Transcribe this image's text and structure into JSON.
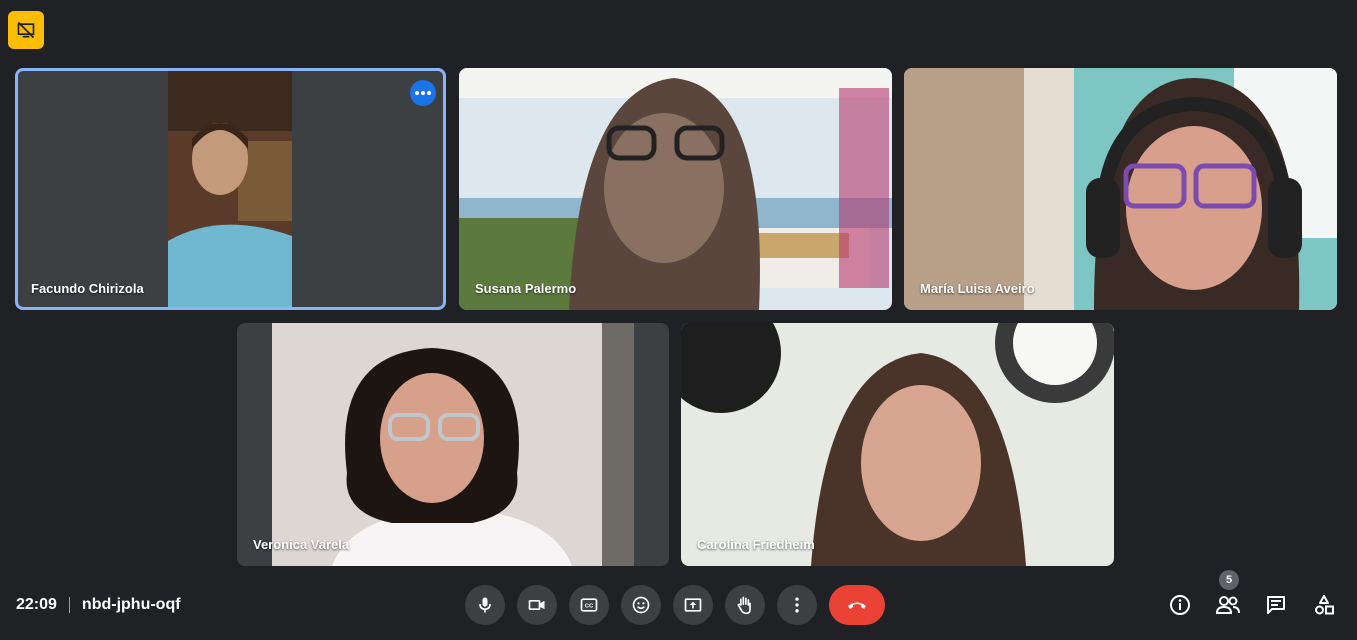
{
  "meeting": {
    "time": "22:09",
    "code": "nbd-jphu-oqf"
  },
  "participants": [
    {
      "name": "Facundo Chirizola"
    },
    {
      "name": "Susana Palermo"
    },
    {
      "name": "María Luisa Aveiro"
    },
    {
      "name": "Veronica Varela"
    },
    {
      "name": "Carolina Friedheim"
    }
  ],
  "people_count": "5",
  "colors": {
    "background": "#202124",
    "tile": "#3c4043",
    "active_outline": "#8ab4f8",
    "end_call": "#ea4335",
    "warning_badge": "#fbbc04"
  },
  "icons": {
    "top_badge": "presentation-off-icon",
    "mic": "mic-icon",
    "camera": "camera-icon",
    "captions": "captions-icon",
    "emoji": "emoji-icon",
    "present": "present-screen-icon",
    "raise_hand": "raise-hand-icon",
    "more": "more-vert-icon",
    "end_call": "end-call-icon",
    "info": "info-icon",
    "people": "people-icon",
    "chat": "chat-icon",
    "activities": "activities-icon"
  }
}
